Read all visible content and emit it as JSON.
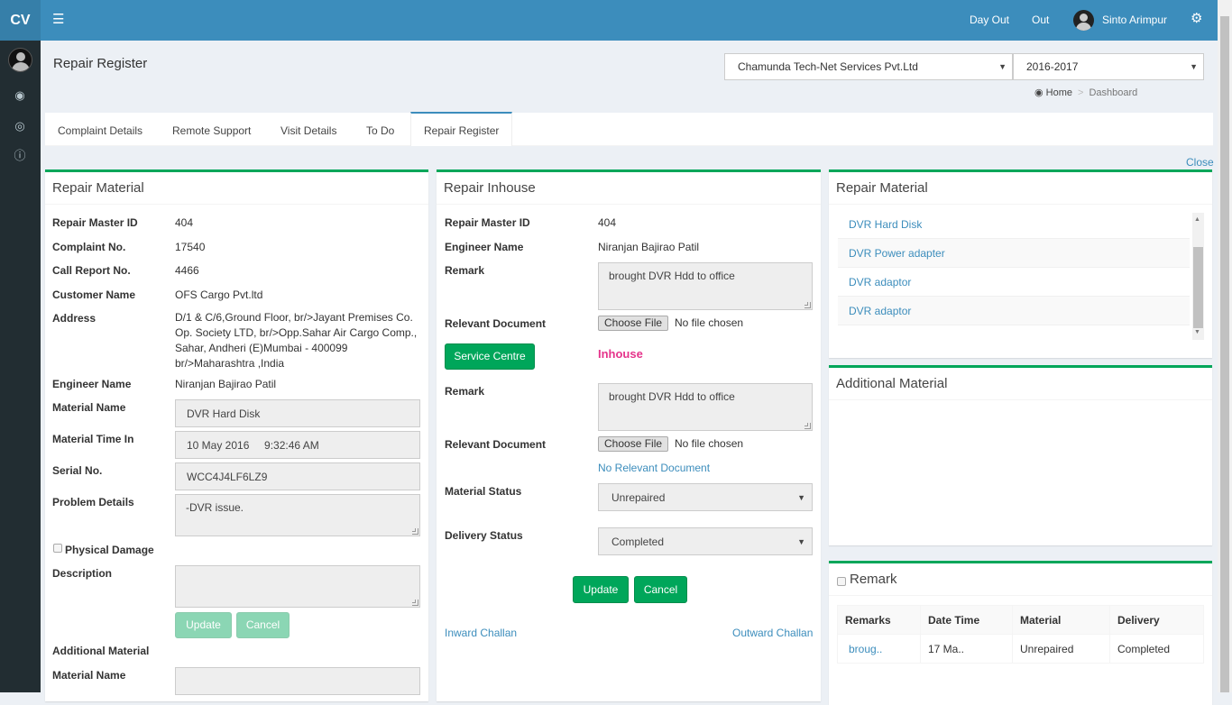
{
  "app": {
    "logo": "CV"
  },
  "topbar": {
    "day_out": "Day Out",
    "out": "Out",
    "user_name": "Sinto Arimpur"
  },
  "header": {
    "title": "Repair Register",
    "company_select": "Chamunda Tech-Net Services Pvt.Ltd",
    "year_select": "2016-2017",
    "breadcrumb": {
      "home": "Home",
      "sep": ">",
      "current": "Dashboard"
    }
  },
  "tabs": [
    "Complaint Details",
    "Remote Support",
    "Visit Details",
    "To Do",
    "Repair Register"
  ],
  "close_label": "Close",
  "left": {
    "title": "Repair Material",
    "labels": {
      "repair_master_id": "Repair Master ID",
      "complaint_no": "Complaint No.",
      "call_report_no": "Call Report No.",
      "customer_name": "Customer Name",
      "address": "Address",
      "engineer_name": "Engineer Name",
      "material_name": "Material Name",
      "material_time_in": "Material Time In",
      "serial_no": "Serial No.",
      "problem_details": "Problem Details",
      "physical_damage": "Physical Damage",
      "description": "Description",
      "additional_material": "Additional Material",
      "material_name2": "Material Name"
    },
    "values": {
      "repair_master_id": "404",
      "complaint_no": "17540",
      "call_report_no": "4466",
      "customer_name": "OFS Cargo Pvt.ltd",
      "address_lines": [
        "D/1 & C/6,Ground Floor, br/>Jayant Premises Co.",
        "Op. Society LTD, br/>Opp.Sahar Air Cargo Comp.,",
        "Sahar, Andheri (E)Mumbai - 400099",
        "br/>Maharashtra ,India"
      ],
      "engineer_name": "Niranjan Bajirao Patil",
      "material_name": "DVR Hard Disk",
      "material_time_in": "10 May 2016     9:32:46 AM",
      "serial_no": "WCC4J4LF6LZ9",
      "problem_details": "-DVR issue.",
      "description": "",
      "material_name2": ""
    },
    "buttons": {
      "update": "Update",
      "cancel": "Cancel"
    }
  },
  "middle": {
    "title": "Repair Inhouse",
    "labels": {
      "repair_master_id": "Repair Master ID",
      "engineer_name": "Engineer Name",
      "remark": "Remark",
      "relevant_document": "Relevant Document",
      "remark2": "Remark",
      "relevant_document2": "Relevant Document",
      "material_status": "Material Status",
      "delivery_status": "Delivery Status"
    },
    "values": {
      "repair_master_id": "404",
      "engineer_name": "Niranjan Bajirao Patil",
      "remark": "brought DVR Hdd to office",
      "remark2": "brought DVR Hdd to office",
      "material_status": "Unrepaired",
      "delivery_status": "Completed"
    },
    "file": {
      "button": "Choose File",
      "status": "No file chosen"
    },
    "service_centre": "Service Centre",
    "inhouse_label": "Inhouse",
    "no_document": "No Relevant Document",
    "buttons": {
      "update": "Update",
      "cancel": "Cancel"
    },
    "links": {
      "inward": "Inward Challan",
      "outward": "Outward Challan"
    },
    "colors": {
      "inhouse": "#e5348b"
    }
  },
  "right": {
    "material_title": "Repair Material",
    "materials": [
      "DVR Hard Disk",
      "DVR Power adapter",
      "DVR adaptor",
      "DVR adaptor"
    ],
    "additional_title": "Additional Material",
    "remark_title": "Remark",
    "remark_table": {
      "headers": [
        "Remarks",
        "Date Time",
        "Material",
        "Delivery"
      ],
      "rows": [
        [
          "broug..",
          "17 Ma..",
          "Unrepaired",
          "Completed"
        ]
      ]
    }
  },
  "colors": {
    "primary": "#3c8dbc",
    "success": "#00a65a",
    "sidebar": "#222d32"
  }
}
